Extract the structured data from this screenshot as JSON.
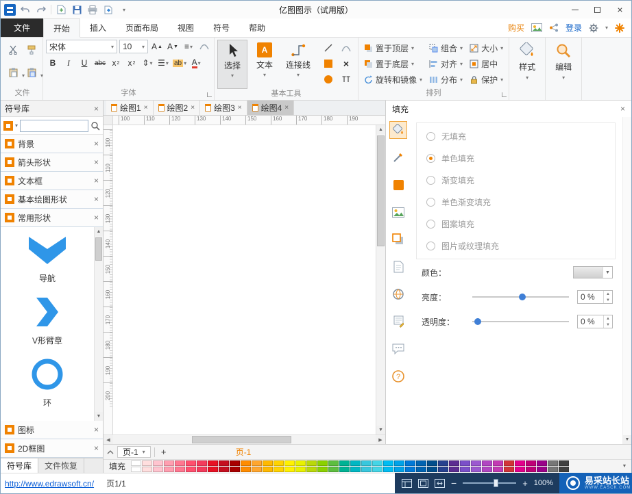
{
  "colors": {
    "accent": "#f08200",
    "login_blue": "#1464c8",
    "status_bg": "#1d3b5e",
    "shape_blue": "#2f96e8"
  },
  "titlebar": {
    "title": "亿图图示（试用版）"
  },
  "tabrow": {
    "file_tab": "文件",
    "tabs": [
      {
        "label": "开始",
        "active": true
      },
      {
        "label": "插入"
      },
      {
        "label": "页面布局"
      },
      {
        "label": "视图"
      },
      {
        "label": "符号"
      },
      {
        "label": "帮助"
      }
    ],
    "buy": "购买",
    "login": "登录"
  },
  "ribbon": {
    "groups": {
      "clipboard_label": "文件",
      "font": {
        "label": "字体",
        "family": "宋体",
        "size": "10"
      },
      "tools": {
        "label": "基本工具",
        "select": "选择",
        "text": "文本",
        "connector": "连接线"
      },
      "arrange": {
        "label": "排列",
        "items": [
          "置于顶层",
          "组合",
          "大小",
          "置于底层",
          "对齐",
          "居中",
          "旋转和镜像",
          "分布",
          "保护"
        ]
      },
      "style": {
        "label": "样式"
      },
      "edit": {
        "label": "编辑"
      }
    }
  },
  "left_panel": {
    "title": "符号库",
    "sections": [
      "背景",
      "箭头形状",
      "文本框",
      "基本绘图形状",
      "常用形状"
    ],
    "shapes": [
      {
        "label": "导航"
      },
      {
        "label": "V形臂章"
      },
      {
        "label": "环"
      }
    ],
    "bottom_sections": [
      "图标",
      "2D框图"
    ],
    "tabs": [
      {
        "label": "符号库",
        "active": true
      },
      {
        "label": "文件恢复"
      }
    ]
  },
  "canvas": {
    "doc_tabs": [
      {
        "label": "绘图1"
      },
      {
        "label": "绘图2"
      },
      {
        "label": "绘图3"
      },
      {
        "label": "绘图4",
        "active": true
      }
    ],
    "h_ruler": [
      "100",
      "110",
      "120",
      "130",
      "140",
      "150",
      "160",
      "170",
      "180",
      "190"
    ],
    "v_ruler": [
      "100",
      "110",
      "120",
      "130",
      "140",
      "150",
      "160",
      "170",
      "180",
      "190",
      "200"
    ],
    "page_tab": "页-1",
    "add_page": "+",
    "current_page": "页-1"
  },
  "right_panel": {
    "title": "填充",
    "options": [
      "无填充",
      "单色填充",
      "渐变填充",
      "单色渐变填充",
      "图案填充",
      "图片或纹理填充"
    ],
    "selected_index": 1,
    "color_label": "颜色：",
    "brightness_label": "亮度：",
    "brightness_value": "0 %",
    "transparency_label": "透明度：",
    "transparency_value": "0 %"
  },
  "bottom_bar": {
    "fill_label": "填充",
    "palette": [
      "#ffffff",
      "#ffdede",
      "#ffc4cf",
      "#ff9eb0",
      "#ff7790",
      "#ff4f6e",
      "#f43b5c",
      "#e81123",
      "#c50f1f",
      "#a80000",
      "#ff8c00",
      "#ffa62f",
      "#ffb900",
      "#ffd300",
      "#fff100",
      "#e8f100",
      "#bad80a",
      "#8bd100",
      "#5dbe3f",
      "#00b294",
      "#00b7c3",
      "#38c7dd",
      "#45d5e6",
      "#00bcf2",
      "#00a2e8",
      "#0078d7",
      "#0063b1",
      "#004e8c",
      "#26418f",
      "#5c2d91",
      "#7b4fc9",
      "#9b59d0",
      "#b146c2",
      "#c239b3",
      "#d13438",
      "#e3008c",
      "#bf0077",
      "#9a0089",
      "#777777",
      "#404040"
    ]
  },
  "statusbar": {
    "link": "http://www.edrawsoft.cn/",
    "page_info": "页1/1",
    "zoom_value": "100%",
    "watermark_title": "易采站长站",
    "watermark_sub": "WWW.EASCK.COM"
  }
}
